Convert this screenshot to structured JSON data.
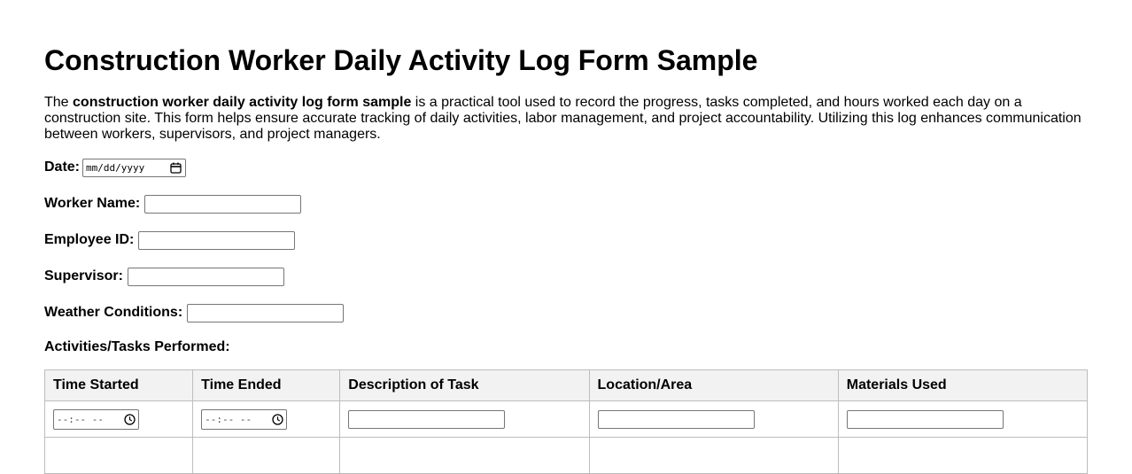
{
  "page": {
    "title": "Construction Worker Daily Activity Log Form Sample",
    "intro": {
      "lead": "The ",
      "bold": "construction worker daily activity log form sample",
      "rest": " is a practical tool used to record the progress, tasks completed, and hours worked each day on a construction site. This form helps ensure accurate tracking of daily activities, labor management, and project accountability. Utilizing this log enhances communication between workers, supervisors, and project managers."
    }
  },
  "form": {
    "date_label": "Date:",
    "date_placeholder": "mm/dd/yyyy",
    "worker_name_label": "Worker Name:",
    "worker_name_value": "",
    "employee_id_label": "Employee ID:",
    "employee_id_value": "",
    "supervisor_label": "Supervisor:",
    "supervisor_value": "",
    "weather_label": "Weather Conditions:",
    "weather_value": ""
  },
  "activities": {
    "heading": "Activities/Tasks Performed:",
    "columns": [
      "Time Started",
      "Time Ended",
      "Description of Task",
      "Location/Area",
      "Materials Used"
    ],
    "time_placeholder": "--:-- --",
    "icons": {
      "date": "calendar-icon",
      "time": "clock-icon"
    }
  }
}
